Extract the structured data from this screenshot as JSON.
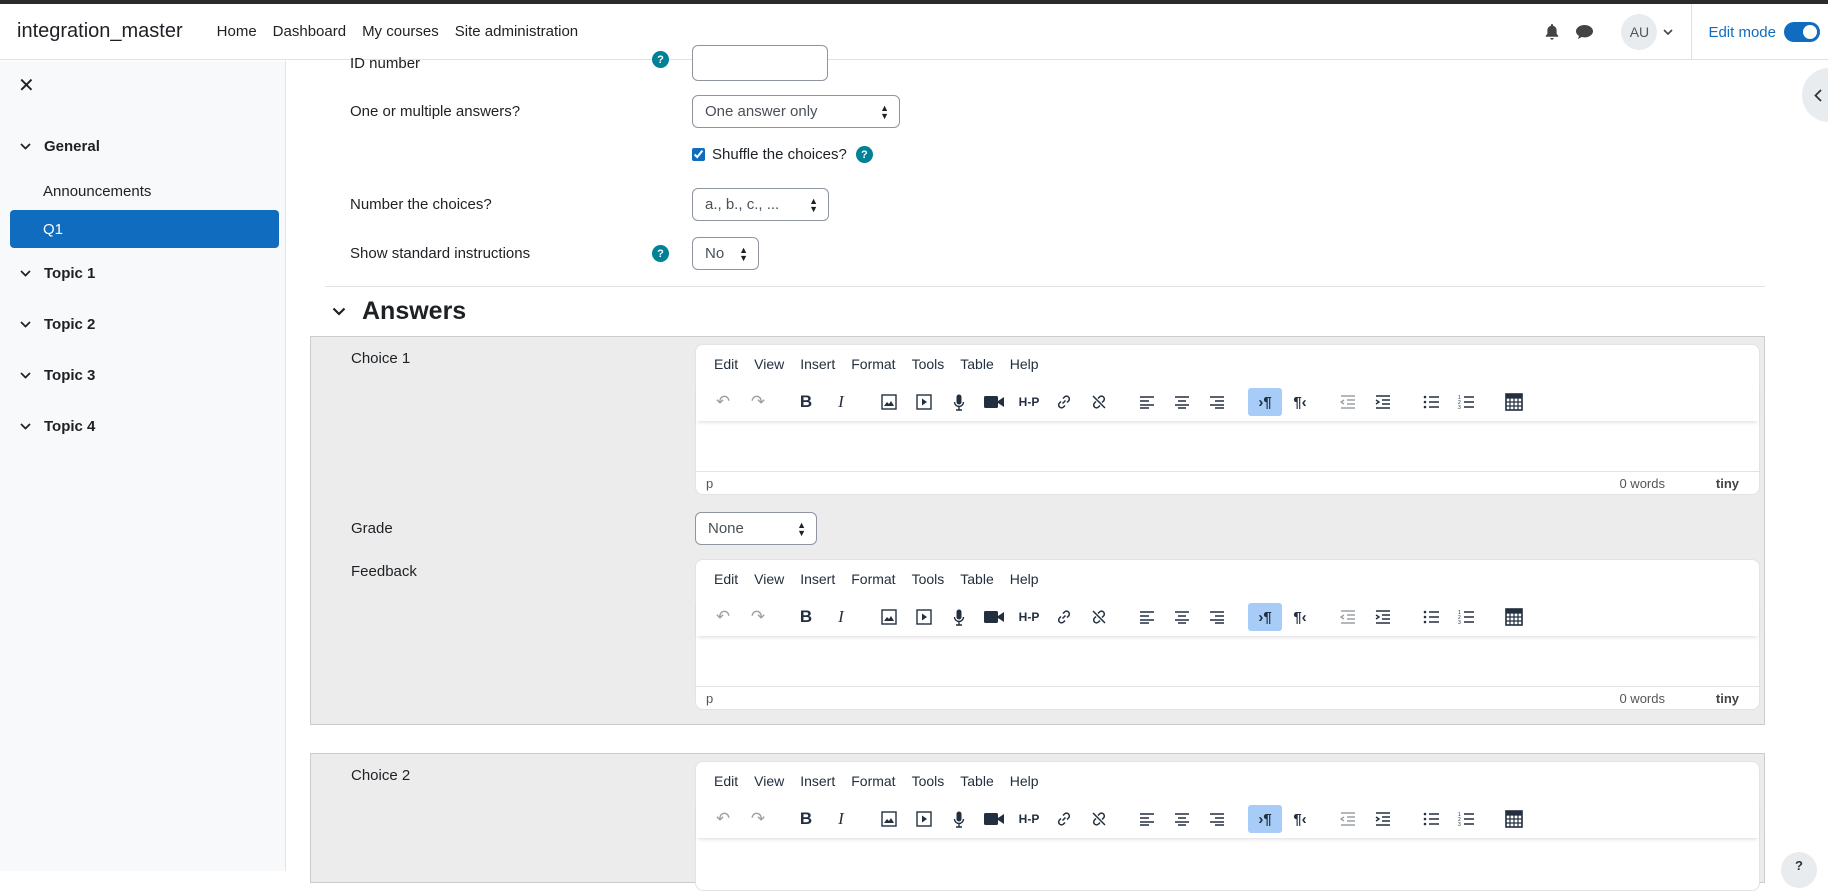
{
  "app": {
    "site_name": "integration_master"
  },
  "primary_nav": [
    "Home",
    "Dashboard",
    "My courses",
    "Site administration"
  ],
  "user": {
    "initials": "AU"
  },
  "edit_mode": {
    "label": "Edit mode",
    "enabled": true
  },
  "drawer": {
    "sections": [
      {
        "label": "General",
        "items": [
          {
            "label": "Announcements",
            "active": false
          },
          {
            "label": "Q1",
            "active": true
          }
        ]
      },
      {
        "label": "Topic 1",
        "items": []
      },
      {
        "label": "Topic 2",
        "items": []
      },
      {
        "label": "Topic 3",
        "items": []
      },
      {
        "label": "Topic 4",
        "items": []
      }
    ]
  },
  "form": {
    "id_number_label": "ID number",
    "answers_label": "One or multiple answers?",
    "answers_value": "One answer only",
    "shuffle_label": "Shuffle the choices?",
    "shuffle_checked": true,
    "number_choices_label": "Number the choices?",
    "number_choices_value": "a., b., c., ...",
    "std_instr_label": "Show standard instructions",
    "std_instr_value": "No",
    "help_glyph": "?"
  },
  "answers": {
    "heading": "Answers",
    "choice1_label": "Choice 1",
    "grade_label": "Grade",
    "grade_value": "None",
    "feedback_label": "Feedback",
    "choice2_label": "Choice 2"
  },
  "editor": {
    "menu": [
      "Edit",
      "View",
      "Insert",
      "Format",
      "Tools",
      "Table",
      "Help"
    ],
    "status_path": "p",
    "word_count": "0 words",
    "brand": "tiny"
  }
}
